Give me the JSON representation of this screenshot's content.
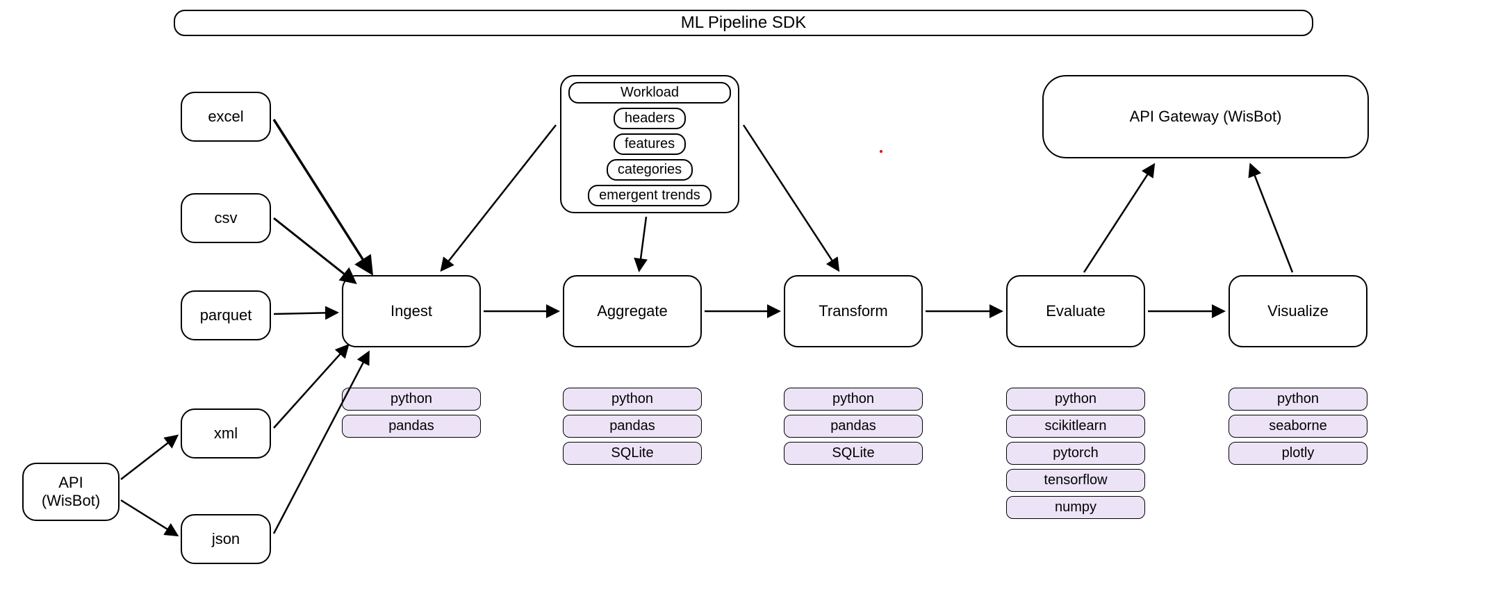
{
  "title": "ML Pipeline SDK",
  "api_source": "API\n(WisBot)",
  "gateway": "API Gateway (WisBot)",
  "sources": {
    "excel": "excel",
    "csv": "csv",
    "parquet": "parquet",
    "xml": "xml",
    "json": "json"
  },
  "stages": {
    "ingest": "Ingest",
    "aggregate": "Aggregate",
    "transform": "Transform",
    "evaluate": "Evaluate",
    "visualize": "Visualize"
  },
  "workload": {
    "title": "Workload",
    "items": [
      "headers",
      "features",
      "categories",
      "emergent trends"
    ]
  },
  "tech": {
    "ingest": [
      "python",
      "pandas"
    ],
    "aggregate": [
      "python",
      "pandas",
      "SQLite"
    ],
    "transform": [
      "python",
      "pandas",
      "SQLite"
    ],
    "evaluate": [
      "python",
      "scikitlearn",
      "pytorch",
      "tensorflow",
      "numpy"
    ],
    "visualize": [
      "python",
      "seaborne",
      "plotly"
    ]
  }
}
